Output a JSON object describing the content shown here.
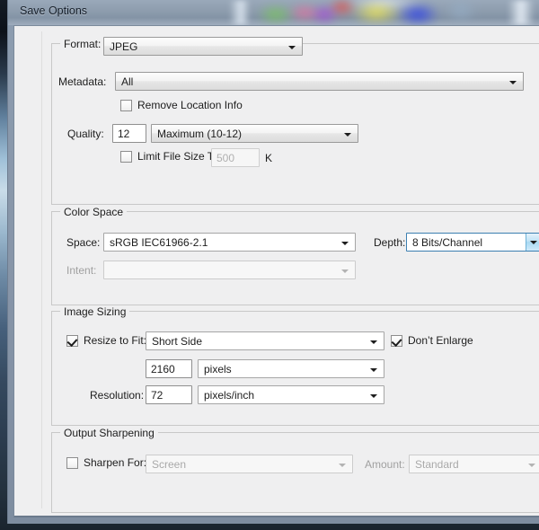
{
  "window": {
    "title": "Save Options"
  },
  "format_group": {
    "legend": "Format:",
    "format_combo": {
      "value": "JPEG"
    },
    "metadata_label": "Metadata:",
    "metadata_combo": {
      "value": "All"
    },
    "remove_location_checkbox": {
      "label": "Remove Location Info",
      "checked": false
    },
    "quality_label": "Quality:",
    "quality_value": "12",
    "quality_combo": {
      "value": "Maximum  (10-12)"
    },
    "limit_filesize_checkbox": {
      "label": "Limit File Size To:",
      "checked": false
    },
    "limit_filesize_value": "500",
    "limit_filesize_unit": "K"
  },
  "color_space_group": {
    "legend": "Color Space",
    "space_label": "Space:",
    "space_combo": {
      "value": "sRGB IEC61966-2.1"
    },
    "depth_label": "Depth:",
    "depth_combo": {
      "value": "8 Bits/Channel"
    },
    "intent_label": "Intent:",
    "intent_combo": {
      "value": ""
    }
  },
  "image_sizing_group": {
    "legend": "Image Sizing",
    "resize_to_fit_checkbox": {
      "label": "Resize to Fit:",
      "checked": true
    },
    "resize_combo": {
      "value": "Short Side"
    },
    "dont_enlarge_checkbox": {
      "label": "Don’t Enlarge",
      "checked": true
    },
    "size_value": "2160",
    "size_unit_combo": {
      "value": "pixels"
    },
    "resolution_label": "Resolution:",
    "resolution_value": "72",
    "resolution_unit_combo": {
      "value": "pixels/inch"
    }
  },
  "output_sharpening_group": {
    "legend": "Output Sharpening",
    "sharpen_for_checkbox": {
      "label": "Sharpen For:",
      "checked": false
    },
    "sharpen_for_combo": {
      "value": "Screen"
    },
    "amount_label": "Amount:",
    "amount_combo": {
      "value": "Standard"
    }
  },
  "colors": {
    "dialog_background": "#efeff0",
    "titlebar": "#8e9dae",
    "focus_accent": "#3c7fb1",
    "group_border": "#c8c8c8",
    "text": "#1d1d1d",
    "disabled_text": "#a9a9a9"
  }
}
